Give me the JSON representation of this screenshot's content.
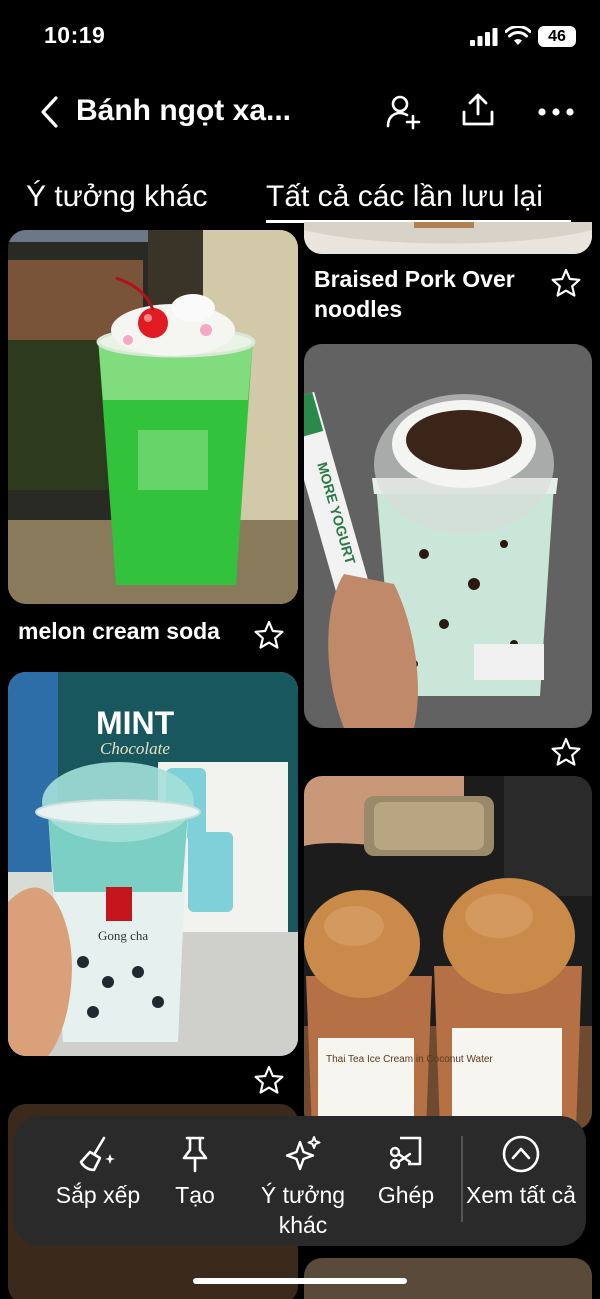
{
  "status_bar": {
    "time": "10:19",
    "battery": "46"
  },
  "header": {
    "title": "Bánh ngọt xa..."
  },
  "tabs": [
    {
      "label": "Ý tưởng khác",
      "selected": false
    },
    {
      "label": "Tất cả các lần lưu lại",
      "selected": true
    }
  ],
  "pins": [
    {
      "title": "Braised Pork Over noodles",
      "image": "braised-pork-dish"
    },
    {
      "title": "melon cream soda",
      "image": "green-melon-cream-soda"
    },
    {
      "title": "",
      "image": "mint-chocolate-yogurt-drink"
    },
    {
      "title": "",
      "image": "gong-cha-mint-chocolate-drink"
    },
    {
      "title": "",
      "image": "thai-tea-ice-cream-cups"
    }
  ],
  "image_text": {
    "yogurt_straw": "MORE YOGURT",
    "mint_poster_line1": "MINT",
    "mint_poster_line2": "Chocolate",
    "gongcha_brand": "Gong cha",
    "thai_cup_label": "Thai Tea Ice Cream in Coconut Water"
  },
  "toolbar": {
    "items": [
      {
        "label": "Sắp xếp",
        "icon": "broom-sparkle-icon"
      },
      {
        "label": "Tạo",
        "icon": "pin-icon"
      },
      {
        "label": "Ý tưởng khác",
        "icon": "sparkle-icon"
      },
      {
        "label": "Ghép",
        "icon": "scissors-collage-icon"
      },
      {
        "label": "Xem tất cả",
        "icon": "chevron-up-circle-icon"
      }
    ]
  },
  "colors": {
    "background": "#000000",
    "toolbar": "#2a2a2a",
    "text": "#ffffff"
  }
}
